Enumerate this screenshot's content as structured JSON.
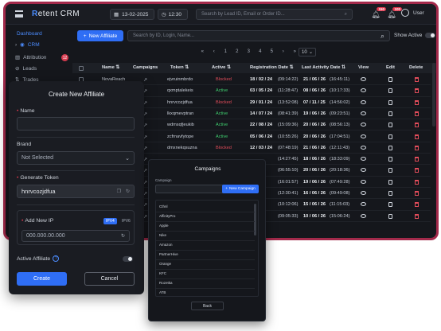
{
  "header": {
    "logo_prefix": "R",
    "logo_text": "etent CRM",
    "date": "13-02-2025",
    "time": "12:30",
    "search_placeholder": "Search by Lead ID, Email or Order ID...",
    "notif1_count": "150",
    "notif2_count": "100",
    "user_label": "User"
  },
  "sidebar": {
    "items": [
      {
        "label": "Dashboard"
      },
      {
        "label": "CRM"
      },
      {
        "label": "Attribution",
        "count": "12"
      },
      {
        "label": "Leads"
      },
      {
        "label": "Trades"
      }
    ]
  },
  "toolbar": {
    "new_affiliate_label": "New Affiliate",
    "search_placeholder": "Search by ID, Login, Name...",
    "show_active_label": "Show Active"
  },
  "pager": {
    "pages": [
      "«",
      "‹",
      "1",
      "2",
      "3",
      "4",
      "5",
      "›",
      "»"
    ],
    "page_size": "10"
  },
  "table": {
    "headers": [
      "Name",
      "Campaigns",
      "Token",
      "Active",
      "Registration Date",
      "Last Activity Date",
      "View",
      "Edit",
      "Delete"
    ],
    "rows": [
      {
        "name": "NovaReach",
        "token": "ejvruinmbrdo",
        "status": "Blocked",
        "reg_date": "18 / 02 / 24",
        "reg_time": "(09:14:22)",
        "act_date": "21 / 06 / 26",
        "act_time": "(16:45:11)"
      },
      {
        "name": "",
        "token": "qxmptalekeis",
        "status": "Active",
        "reg_date": "03 / 05 / 24",
        "reg_time": "(11:28:47)",
        "act_date": "08 / 06 / 26",
        "act_time": "(10:17:33)"
      },
      {
        "name": "",
        "token": "hnrvcozjdfua",
        "status": "Blocked",
        "reg_date": "29 / 01 / 24",
        "reg_time": "(13:52:08)",
        "act_date": "07 / 11 / 25",
        "act_time": "(14:56:02)"
      },
      {
        "name": "",
        "token": "lkxqmevptran",
        "status": "Active",
        "reg_date": "14 / 07 / 24",
        "reg_time": "(08:41:39)",
        "act_date": "19 / 06 / 26",
        "act_time": "(09:23:51)"
      },
      {
        "name": "",
        "token": "wdmsqfjeukib",
        "status": "Active",
        "reg_date": "22 / 08 / 24",
        "reg_time": "(15:09:36)",
        "act_date": "20 / 06 / 26",
        "act_time": "(08:56:13)"
      },
      {
        "name": "",
        "token": "zcfrnavfytope",
        "status": "Active",
        "reg_date": "05 / 06 / 24",
        "reg_time": "(10:55:26)",
        "act_date": "20 / 06 / 26",
        "act_time": "(17:04:51)"
      },
      {
        "name": "",
        "token": "dmxnekqsuzna",
        "status": "Blocked",
        "reg_date": "12 / 03 / 24",
        "reg_time": "(07:48:19)",
        "act_date": "21 / 06 / 26",
        "act_time": "(12:11:43)"
      },
      {
        "name": "",
        "token": "",
        "status": "",
        "reg_date": "",
        "reg_time": "(14:27:45)",
        "act_date": "18 / 06 / 26",
        "act_time": "(18:33:09)"
      },
      {
        "name": "",
        "token": "",
        "status": "",
        "reg_date": "",
        "reg_time": "(06:55:10)",
        "act_date": "20 / 06 / 26",
        "act_time": "(20:18:36)"
      },
      {
        "name": "",
        "token": "",
        "status": "",
        "reg_date": "",
        "reg_time": "(16:01:57)",
        "act_date": "19 / 06 / 26",
        "act_time": "(07:49:28)"
      },
      {
        "name": "",
        "token": "",
        "status": "",
        "reg_date": "",
        "reg_time": "(12:30:41)",
        "act_date": "16 / 06 / 26",
        "act_time": "(09:49:08)"
      },
      {
        "name": "",
        "token": "",
        "status": "",
        "reg_date": "",
        "reg_time": "(10:12:06)",
        "act_date": "15 / 06 / 26",
        "act_time": "(11:15:03)"
      },
      {
        "name": "",
        "token": "",
        "status": "",
        "reg_date": "",
        "reg_time": "(09:05:33)",
        "act_date": "10 / 06 / 26",
        "act_time": "(15:06:24)"
      }
    ]
  },
  "create_panel": {
    "title": "Create New Affiliate",
    "name_label": "Name",
    "brand_label": "Brand",
    "brand_value": "Not Selected",
    "token_label": "Generate Token",
    "token_value": "hnrvcozjdfua",
    "ip_label": "Add New IP",
    "ipv4_label": "IPV4",
    "ipv6_label": "IPV6",
    "ip_placeholder": "000.000.00.000",
    "active_label": "Active Affiliate",
    "info_glyph": "?",
    "create_label": "Create",
    "cancel_label": "Cancel"
  },
  "campaigns_popup": {
    "title": "Campaigns",
    "campaign_label": "Campaign",
    "new_campaign_label": "New Campaign",
    "items": [
      "Cthnl",
      "AffinityPro",
      "Apple",
      "Nike",
      "Amazon",
      "PartnerHive",
      "Orange",
      "KFC",
      "Rozetka",
      "ATB"
    ],
    "back_label": "Back"
  }
}
